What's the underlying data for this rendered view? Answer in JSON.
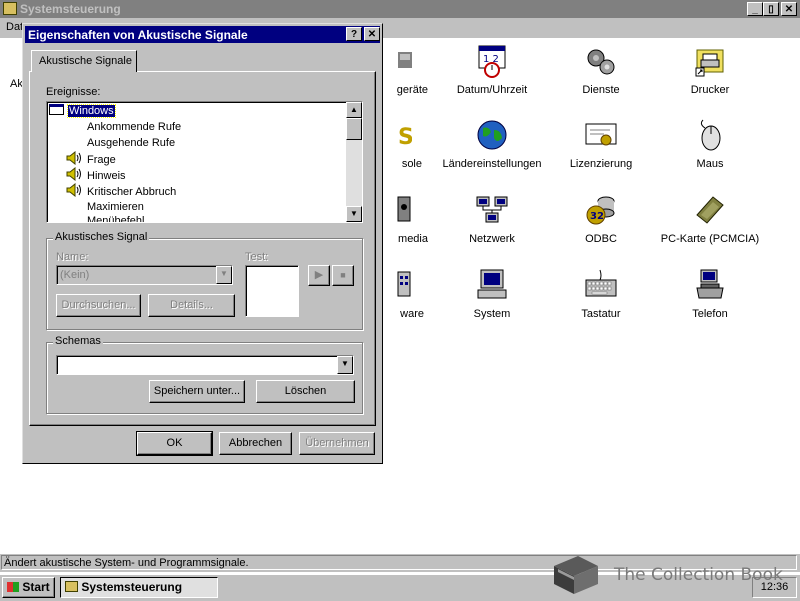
{
  "window": {
    "title": "Systemsteuerung",
    "menu_partial": "Dat",
    "behind_dialog_partial": "Ak",
    "minimize": "_",
    "maximize": "▯",
    "close": "✕"
  },
  "control_panel": {
    "items": [
      {
        "label": "geräte",
        "icon": "printer-device-icon"
      },
      {
        "label": "Datum/Uhrzeit",
        "icon": "calendar-clock-icon"
      },
      {
        "label": "Dienste",
        "icon": "gears-icon"
      },
      {
        "label": "Drucker",
        "icon": "printer-folder-icon"
      },
      {
        "label": "sole",
        "icon": "console-icon"
      },
      {
        "label": "Ländereinstellungen",
        "icon": "globe-icon"
      },
      {
        "label": "Lizenzierung",
        "icon": "certificate-icon"
      },
      {
        "label": "Maus",
        "icon": "mouse-icon"
      },
      {
        "label": "media",
        "icon": "multimedia-icon"
      },
      {
        "label": "Netzwerk",
        "icon": "network-icon"
      },
      {
        "label": "ODBC",
        "icon": "odbc-icon"
      },
      {
        "label": "PC-Karte (PCMCIA)",
        "icon": "pc-card-icon"
      },
      {
        "label": "ware",
        "icon": "hardware-icon"
      },
      {
        "label": "System",
        "icon": "computer-icon"
      },
      {
        "label": "Tastatur",
        "icon": "keyboard-icon"
      },
      {
        "label": "Telefon",
        "icon": "telephone-icon"
      }
    ]
  },
  "dialog": {
    "title": "Eigenschaften von Akustische Signale",
    "help_btn": "?",
    "close_btn": "✕",
    "tab": "Akustische Signale",
    "events_label": "Ereignisse:",
    "events": [
      {
        "label": "Windows",
        "selected": true,
        "sound": false,
        "root": true
      },
      {
        "label": "Ankommende Rufe",
        "sound": false
      },
      {
        "label": "Ausgehende Rufe",
        "sound": false
      },
      {
        "label": "Frage",
        "sound": true
      },
      {
        "label": "Hinweis",
        "sound": true
      },
      {
        "label": "Kritischer Abbruch",
        "sound": true
      },
      {
        "label": "Maximieren",
        "sound": false
      },
      {
        "label": "Menübefehl",
        "sound": false
      }
    ],
    "sound_group": "Akustisches Signal",
    "name_label": "Name:",
    "name_value": "(Kein)",
    "test_label": "Test:",
    "browse_btn": "Durchsuchen...",
    "details_btn": "Details...",
    "schemes_group": "Schemas",
    "scheme_value": "",
    "save_as_btn": "Speichern unter...",
    "delete_btn": "Löschen",
    "ok_btn": "OK",
    "cancel_btn": "Abbrechen",
    "apply_btn": "Übernehmen"
  },
  "status_bar": {
    "text": "Ändert akustische System- und Programmsignale."
  },
  "taskbar": {
    "start": "Start",
    "task": "Systemsteuerung",
    "clock": "12:36"
  },
  "watermark": {
    "text": "The Collection Book"
  }
}
